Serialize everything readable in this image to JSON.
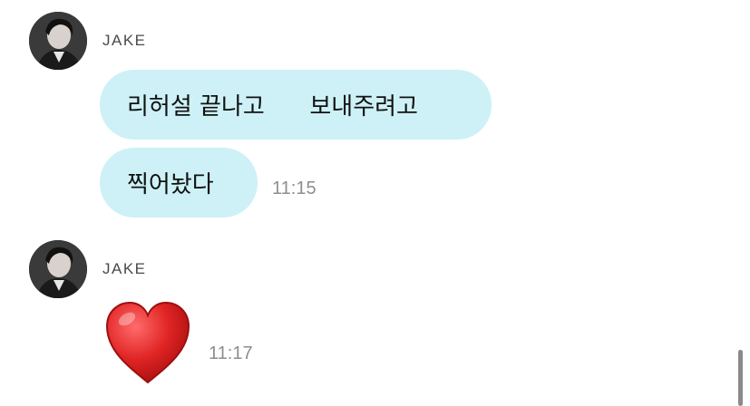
{
  "messages": [
    {
      "sender": "JAKE",
      "bubbles": [
        "리허설 끝나고      보내주려고",
        "찍어놨다"
      ],
      "time": "11:15"
    },
    {
      "sender": "JAKE",
      "emoji": "heart",
      "time": "11:17"
    }
  ],
  "colors": {
    "bubble_background": "#cdf1f6",
    "timestamp": "#8e8e8e",
    "sender_name": "#4a4a4a",
    "heart": "#e02424"
  }
}
